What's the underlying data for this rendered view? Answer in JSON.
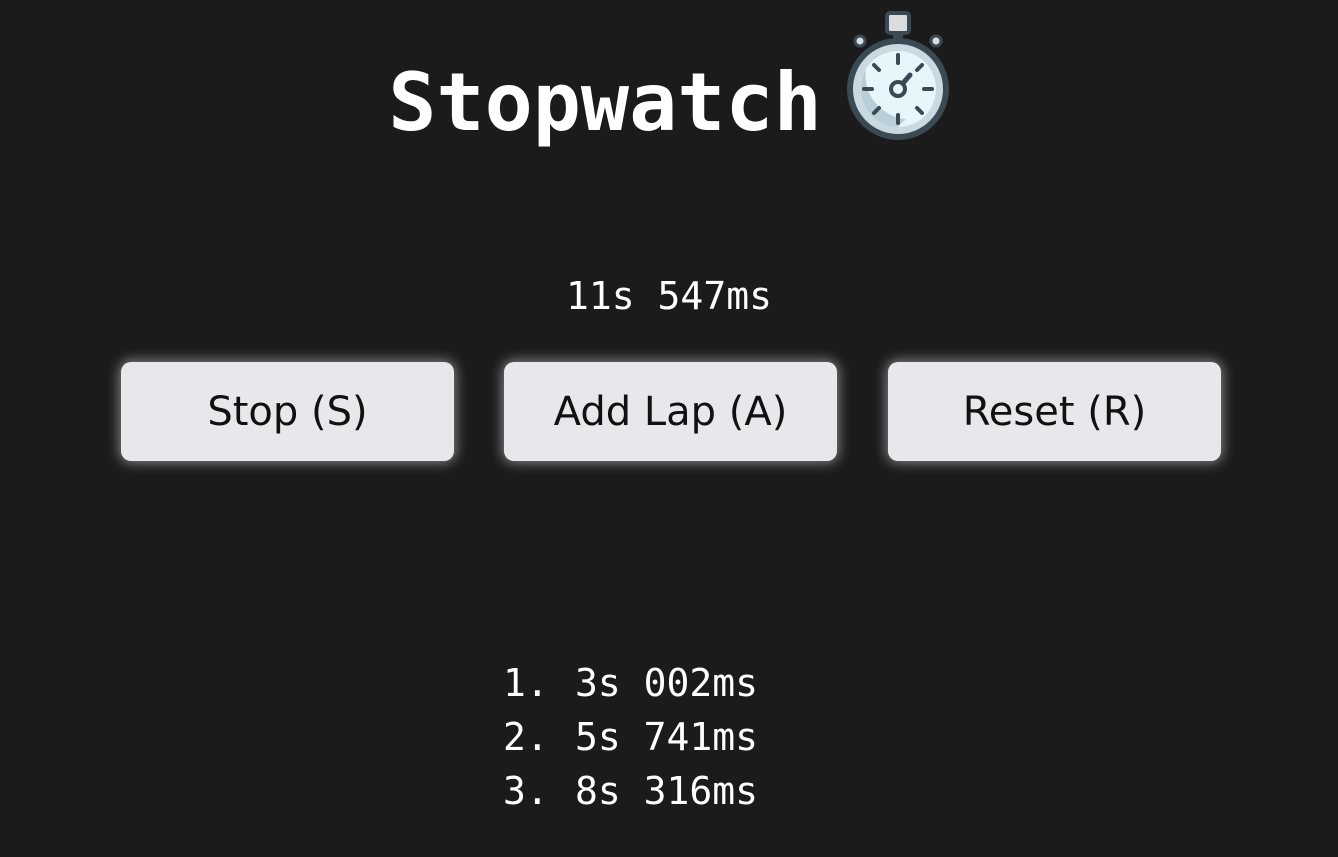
{
  "header": {
    "title": "Stopwatch",
    "icon": "stopwatch-icon"
  },
  "timer": {
    "elapsed": "11s 547ms"
  },
  "controls": {
    "stop_label": "Stop (S)",
    "lap_label": "Add Lap (A)",
    "reset_label": "Reset (R)"
  },
  "laps": [
    {
      "number": "1.",
      "time": "3s 002ms"
    },
    {
      "number": "2.",
      "time": "5s 741ms"
    },
    {
      "number": "3.",
      "time": "8s 316ms"
    }
  ],
  "colors": {
    "background": "#1b1b1b",
    "button": "#e8e7ec",
    "text": "#ffffff"
  }
}
